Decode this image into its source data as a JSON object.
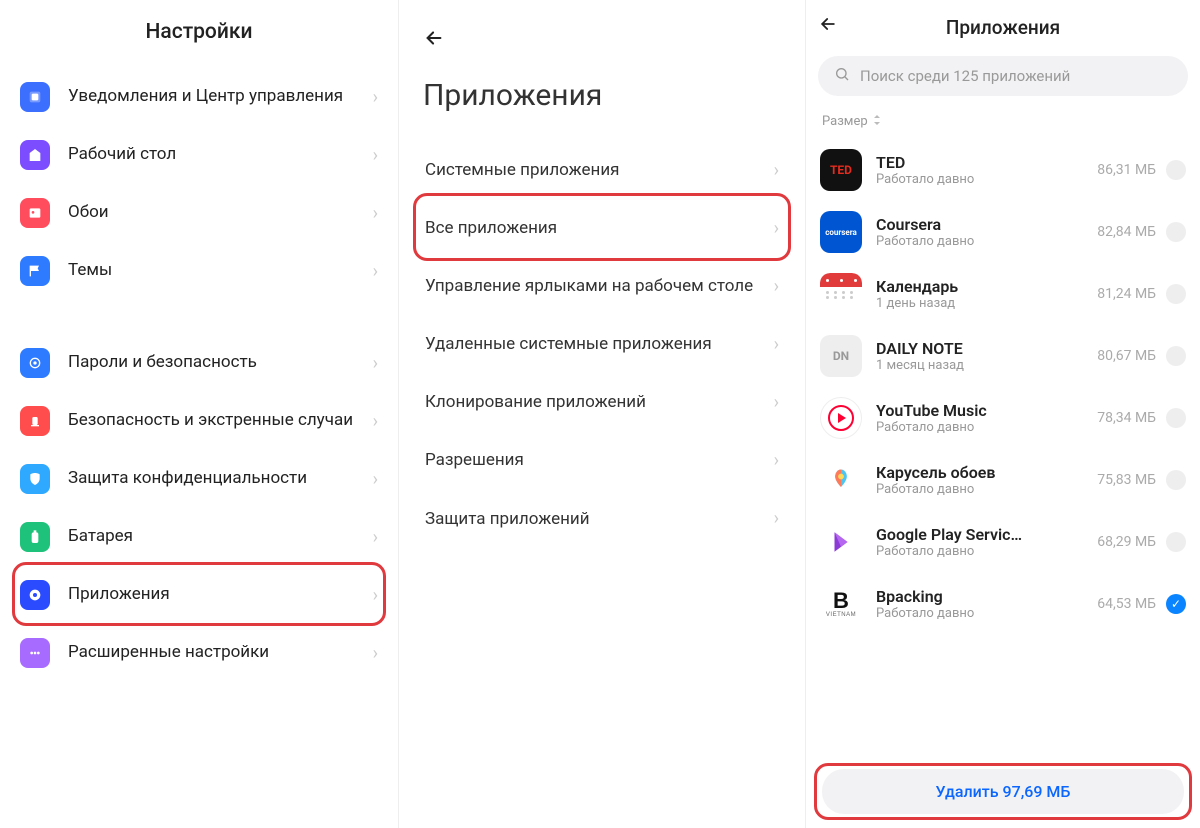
{
  "panel1": {
    "title": "Настройки",
    "items": [
      {
        "label": "Уведомления и Центр управления",
        "icon_bg": "#3d6fff"
      },
      {
        "label": "Рабочий стол",
        "icon_bg": "#7b4dff"
      },
      {
        "label": "Обои",
        "icon_bg": "#ff4d5e"
      },
      {
        "label": "Темы",
        "icon_bg": "#2f7bff"
      }
    ],
    "items2": [
      {
        "label": "Пароли и безопасность",
        "icon_bg": "#2f7bff"
      },
      {
        "label": "Безопасность и экстренные случаи",
        "icon_bg": "#ff4d4d"
      },
      {
        "label": "Защита конфиденциальности",
        "icon_bg": "#2fa8ff"
      },
      {
        "label": "Батарея",
        "icon_bg": "#1fc27a"
      },
      {
        "label": "Приложения",
        "icon_bg": "#2b4bff",
        "highlight": true
      },
      {
        "label": "Расширенные настройки",
        "icon_bg": "#a86bff"
      }
    ]
  },
  "panel2": {
    "title": "Приложения",
    "items": [
      {
        "label": "Системные приложения"
      },
      {
        "label": "Все приложения",
        "highlight": true
      },
      {
        "label": "Управление ярлыками на рабочем столе"
      },
      {
        "label": "Удаленные системные приложения"
      },
      {
        "label": "Клонирование приложений"
      },
      {
        "label": "Разрешения"
      },
      {
        "label": "Защита приложений"
      }
    ]
  },
  "panel3": {
    "title": "Приложения",
    "search_placeholder": "Поиск среди 125 приложений",
    "sort_label": "Размер",
    "apps": [
      {
        "name": "TED",
        "sub": "Работало давно",
        "size": "86,31 МБ",
        "icon_bg": "#111",
        "icon_text": "TED",
        "icon_fg": "#e62b1e"
      },
      {
        "name": "Coursera",
        "sub": "Работало давно",
        "size": "82,84 МБ",
        "icon_bg": "#0056d2",
        "icon_text": "coursera",
        "icon_fg": "#fff"
      },
      {
        "name": "Календарь",
        "sub": "1 день назад",
        "size": "81,24 МБ",
        "icon_bg": "#fff",
        "icon_text": "",
        "icon_fg": "#e33"
      },
      {
        "name": "DAILY NOTE",
        "sub": "1 месяц назад",
        "size": "80,67 МБ",
        "icon_bg": "#eee",
        "icon_text": "DN",
        "icon_fg": "#999"
      },
      {
        "name": "YouTube Music",
        "sub": "Работало давно",
        "size": "78,34 МБ",
        "icon_bg": "#fff",
        "icon_text": "",
        "icon_fg": "#e00"
      },
      {
        "name": "Карусель обоев",
        "sub": "Работало давно",
        "size": "75,83 МБ",
        "icon_bg": "#fff",
        "icon_text": "",
        "icon_fg": "#6ae"
      },
      {
        "name": "Google Play Servic…",
        "sub": "Работало давно",
        "size": "68,29 МБ",
        "icon_bg": "#fff",
        "icon_text": "",
        "icon_fg": "#8c3bd6"
      },
      {
        "name": "Bpacking",
        "sub": "Работало давно",
        "size": "64,53 МБ",
        "icon_bg": "#fff",
        "icon_text": "B",
        "icon_fg": "#111",
        "checked": true
      }
    ],
    "delete_label": "Удалить 97,69 МБ"
  }
}
